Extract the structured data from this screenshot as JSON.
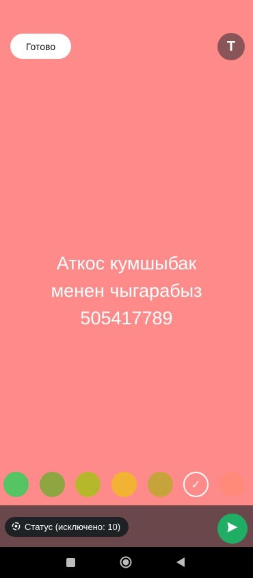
{
  "header": {
    "done_label": "Готово",
    "font_toggle_label": "T"
  },
  "message": {
    "lines": [
      "Аткос кумшыбак",
      "менен чыгарабыз",
      "505417789"
    ]
  },
  "palette": {
    "colors": [
      "#55c463",
      "#8ea642",
      "#b5b82b",
      "#f2b233",
      "#c7a33c",
      "#ff8a8a",
      "#ff8a7a"
    ],
    "selected_index": 5,
    "selected_mark": "✓"
  },
  "status": {
    "label": "Статус (исключено: 10)",
    "icon": "status-ring-icon"
  },
  "send": {
    "icon": "send-icon",
    "color": "#1fae63"
  },
  "colors": {
    "background": "#ff8a8a",
    "bottom_bar": "#6a474b"
  }
}
